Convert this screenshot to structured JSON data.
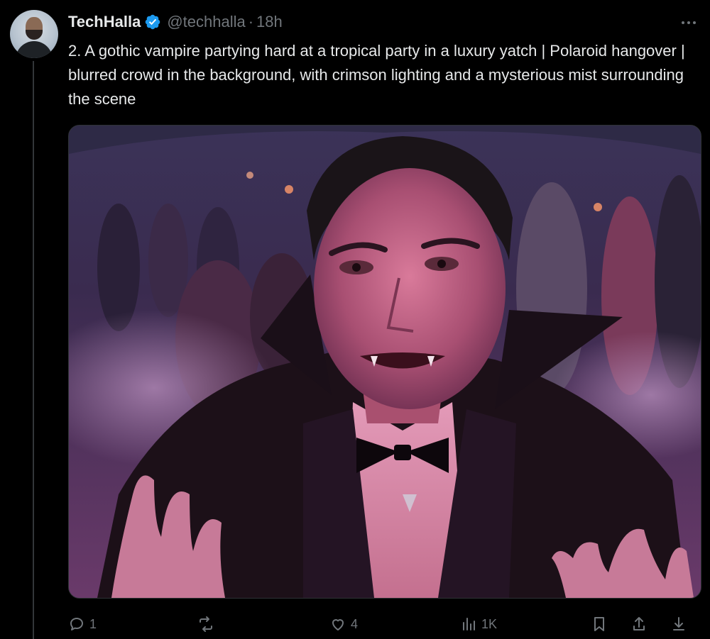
{
  "author": {
    "display_name": "TechHalla",
    "handle": "@techhalla",
    "separator": "·",
    "time": "18h",
    "verified": true,
    "avatar_icon": "profile-avatar"
  },
  "tweet": {
    "text": "2. A gothic vampire partying hard at a tropical party in a luxury yatch | Polaroid hangover | blurred crowd in the background, with crimson lighting and a mysterious mist surrounding the scene",
    "media_icon": "vampire-party-photo"
  },
  "actions": {
    "reply": {
      "icon": "reply-icon",
      "count": "1"
    },
    "retweet": {
      "icon": "retweet-icon",
      "count": ""
    },
    "like": {
      "icon": "heart-icon",
      "count": "4"
    },
    "views": {
      "icon": "views-icon",
      "count": "1K"
    },
    "bookmark": {
      "icon": "bookmark-icon"
    },
    "share": {
      "icon": "share-icon"
    },
    "download": {
      "icon": "download-icon"
    }
  },
  "colors": {
    "background": "#000000",
    "text_primary": "#e7e9ea",
    "text_secondary": "#71767b",
    "verified_blue": "#1d9bf0",
    "border": "#2f3336"
  }
}
